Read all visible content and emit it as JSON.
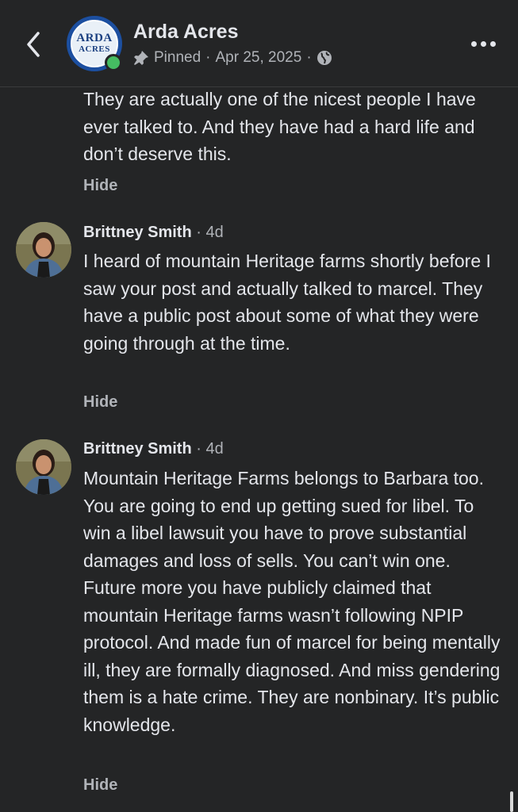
{
  "header": {
    "page_name": "Arda Acres",
    "logo_line1": "ARDA",
    "logo_line2": "ACRES",
    "pinned_label": "Pinned",
    "separator": "·",
    "date": "Apr 25, 2025",
    "separator2": "·"
  },
  "comments": [
    {
      "text": "They are actually one of the nicest people I have ever talked to. And they have had a hard life and don’t deserve this.",
      "hide_label": "Hide"
    },
    {
      "author": "Brittney Smith",
      "age": "· 4d",
      "text": "I heard of mountain Heritage farms shortly before I saw your post and actually talked to marcel. They have a public post about some of what they were going through at the time.",
      "hide_label": "Hide"
    },
    {
      "author": "Brittney Smith",
      "age": "· 4d",
      "text": "Mountain Heritage Farms belongs to Barbara too. You are going to end up getting sued for libel. To win a libel lawsuit you have to prove substantial damages and loss of sells. You can’t win one. Future more you have publicly claimed that mountain Heritage farms wasn’t following NPIP protocol. And made fun of marcel for being mentally ill, they are formally diagnosed. And miss gendering them is a hate crime. They are nonbinary. It’s public knowledge.",
      "hide_label": "Hide"
    }
  ],
  "colors": {
    "background": "#242526",
    "text_primary": "#e4e6eb",
    "text_secondary": "#b0b3b8",
    "online": "#45bd62"
  },
  "icons": {
    "back": "chevron-left-icon",
    "pin": "pin-icon",
    "globe": "globe-icon",
    "more": "more-horizontal-icon"
  }
}
